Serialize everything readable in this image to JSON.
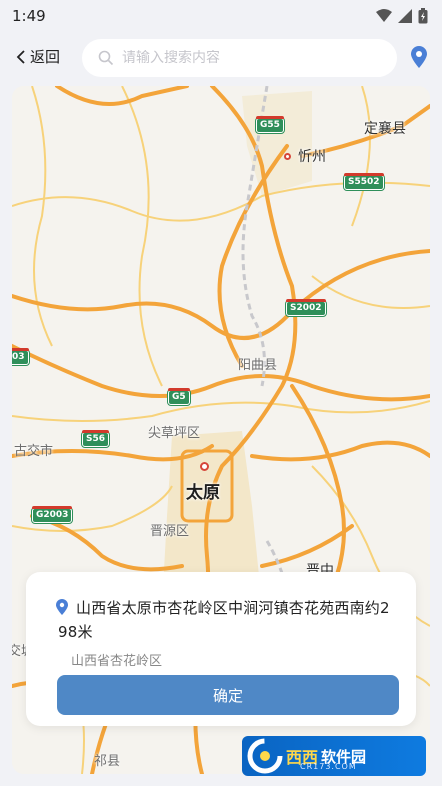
{
  "status_bar": {
    "time": "1:49",
    "icons": [
      "wifi-icon",
      "signal-icon",
      "battery-icon"
    ]
  },
  "header": {
    "back_label": "返回",
    "search_placeholder": "请输入搜索内容",
    "search_value": ""
  },
  "map": {
    "labels": {
      "dingxiang": "定襄县",
      "xinzhou": "忻州",
      "yangqu": "阳曲县",
      "jiancaoping": "尖草坪区",
      "gujiao": "古交市",
      "taiyuan": "太原",
      "jinyuan": "晋源区",
      "jinzhong": "晋中",
      "jiaocheng": "交城",
      "qixian": "祁县"
    },
    "shields": {
      "g55": "G55",
      "s5502": "S5502",
      "s2002": "S2002",
      "g5": "G5",
      "s56": "S56",
      "g2003": "G2003",
      "g3": "03"
    }
  },
  "address_card": {
    "address": "山西省太原市杏花岭区中涧河镇杏花苑西南约298米",
    "sub": "山西省杏花岭区",
    "confirm_label": "确定"
  },
  "watermark": {
    "brand": "西西",
    "label": "软件园",
    "domain": "CR173.COM"
  },
  "colors": {
    "accent": "#4f88c6",
    "pin": "#4a7fd6",
    "road_major": "#f3a43a",
    "road_minor": "#f7d27a"
  }
}
